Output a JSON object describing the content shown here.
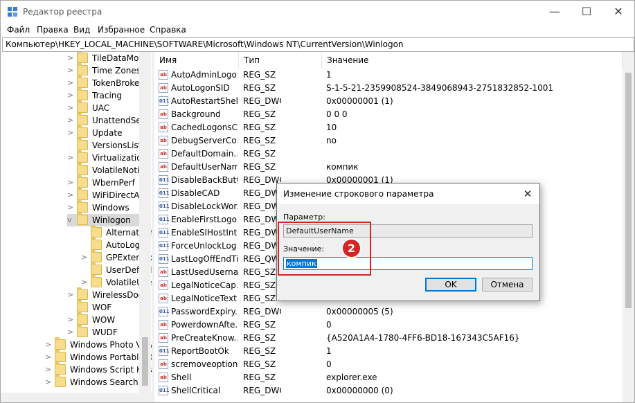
{
  "window": {
    "title": "Редактор реестра",
    "minimize": "—",
    "maximize": "☐",
    "close": "✕"
  },
  "menu": [
    "Файл",
    "Правка",
    "Вид",
    "Избранное",
    "Справка"
  ],
  "address": "Компьютер\\HKEY_LOCAL_MACHINE\\SOFTWARE\\Microsoft\\Windows NT\\CurrentVersion\\Winlogon",
  "tree": [
    {
      "label": "TileDataMode",
      "level": 1,
      "expander": ">"
    },
    {
      "label": "Time Zones",
      "level": 1,
      "expander": ">"
    },
    {
      "label": "TokenBroker",
      "level": 1,
      "expander": ">"
    },
    {
      "label": "Tracing",
      "level": 1,
      "expander": ">"
    },
    {
      "label": "UAC",
      "level": 1,
      "expander": ">"
    },
    {
      "label": "UnattendSetti",
      "level": 1,
      "expander": ">"
    },
    {
      "label": "Update",
      "level": 1,
      "expander": ">"
    },
    {
      "label": "VersionsList",
      "level": 1,
      "expander": ""
    },
    {
      "label": "Virtualization",
      "level": 1,
      "expander": ">"
    },
    {
      "label": "VolatileNotific",
      "level": 1,
      "expander": ""
    },
    {
      "label": "WbemPerf",
      "level": 1,
      "expander": ">"
    },
    {
      "label": "WiFiDirectAPI",
      "level": 1,
      "expander": ">"
    },
    {
      "label": "Windows",
      "level": 1,
      "expander": ">"
    },
    {
      "label": "Winlogon",
      "level": 1,
      "expander": "v",
      "selected": true
    },
    {
      "label": "AlternateSh",
      "level": 2,
      "expander": ""
    },
    {
      "label": "AutoLogon",
      "level": 2,
      "expander": ""
    },
    {
      "label": "GPExtensio",
      "level": 2,
      "expander": ">"
    },
    {
      "label": "UserDefaul",
      "level": 2,
      "expander": ""
    },
    {
      "label": "VolatileUse",
      "level": 2,
      "expander": ">"
    },
    {
      "label": "WirelessDocki",
      "level": 1,
      "expander": ">"
    },
    {
      "label": "WOF",
      "level": 1,
      "expander": ""
    },
    {
      "label": "WOW",
      "level": 1,
      "expander": ">"
    },
    {
      "label": "WUDF",
      "level": 1,
      "expander": ">"
    },
    {
      "label": "Windows Photo View",
      "level": 0,
      "expander": ">"
    },
    {
      "label": "Windows Portable D",
      "level": 0,
      "expander": ">"
    },
    {
      "label": "Windows Script Hos",
      "level": 0,
      "expander": ">"
    },
    {
      "label": "Windows Search",
      "level": 0,
      "expander": ">"
    }
  ],
  "columns": {
    "name": "Имя",
    "type": "Тип",
    "value": "Значение"
  },
  "values": [
    {
      "icon": "sz",
      "name": "AutoAdminLogon",
      "type": "REG_SZ",
      "data": "1"
    },
    {
      "icon": "sz",
      "name": "AutoLogonSID",
      "type": "REG_SZ",
      "data": "S-1-5-21-2359908524-3849068943-2751832852-1001"
    },
    {
      "icon": "dw",
      "name": "AutoRestartShell",
      "type": "REG_DWORD",
      "data": "0x00000001 (1)"
    },
    {
      "icon": "sz",
      "name": "Background",
      "type": "REG_SZ",
      "data": "0 0 0"
    },
    {
      "icon": "sz",
      "name": "CachedLogonsC...",
      "type": "REG_SZ",
      "data": "10"
    },
    {
      "icon": "sz",
      "name": "DebugServerCo...",
      "type": "REG_SZ",
      "data": "no"
    },
    {
      "icon": "sz",
      "name": "DefaultDomain...",
      "type": "REG_SZ",
      "data": ""
    },
    {
      "icon": "sz",
      "name": "DefaultUserName",
      "type": "REG_SZ",
      "data": "компик"
    },
    {
      "icon": "dw",
      "name": "DisableBackButt...",
      "type": "REG_DWORD",
      "data": "0x00000001 (1)"
    },
    {
      "icon": "dw",
      "name": "DisableCAD",
      "type": "REG_DWO",
      "data": ""
    },
    {
      "icon": "dw",
      "name": "DisableLockWor...",
      "type": "REG_DWO",
      "data": ""
    },
    {
      "icon": "dw",
      "name": "EnableFirstLogo...",
      "type": "REG_DWO",
      "data": ""
    },
    {
      "icon": "dw",
      "name": "EnableSIHostInt...",
      "type": "REG_DWO",
      "data": ""
    },
    {
      "icon": "dw",
      "name": "ForceUnlockLog...",
      "type": "REG_DWO",
      "data": ""
    },
    {
      "icon": "dw",
      "name": "LastLogOffEndTi...",
      "type": "REG_QWO",
      "data": ""
    },
    {
      "icon": "sz",
      "name": "LastUsedUserna...",
      "type": "REG_SZ",
      "data": ""
    },
    {
      "icon": "sz",
      "name": "LegalNoticeCap...",
      "type": "REG_SZ",
      "data": ""
    },
    {
      "icon": "sz",
      "name": "LegalNoticeText",
      "type": "REG_SZ",
      "data": ""
    },
    {
      "icon": "dw",
      "name": "PasswordExpiry...",
      "type": "REG_DWORD",
      "data": "0x00000005 (5)"
    },
    {
      "icon": "sz",
      "name": "PowerdownAfte...",
      "type": "REG_SZ",
      "data": "0"
    },
    {
      "icon": "sz",
      "name": "PreCreateKnow...",
      "type": "REG_SZ",
      "data": "{A520A1A4-1780-4FF6-BD18-167343C5AF16}"
    },
    {
      "icon": "dw",
      "name": "ReportBootOk",
      "type": "REG_SZ",
      "data": "1"
    },
    {
      "icon": "sz",
      "name": "scremoveoption",
      "type": "REG_SZ",
      "data": "0"
    },
    {
      "icon": "sz",
      "name": "Shell",
      "type": "REG_SZ",
      "data": "explorer.exe"
    },
    {
      "icon": "dw",
      "name": "ShellCritical",
      "type": "REG_DWORD",
      "data": "0x00000000 (0)"
    }
  ],
  "dialog": {
    "title": "Изменение строкового параметра",
    "close": "✕",
    "param_label": "Параметр:",
    "param_value": "DefaultUserName",
    "value_label": "Значение:",
    "value": "компик",
    "ok": "OK",
    "cancel": "Отмена"
  },
  "badge": "2",
  "colors": {
    "accent": "#0078d7",
    "annotation": "#d62323",
    "folder": "#f6dd8e"
  }
}
